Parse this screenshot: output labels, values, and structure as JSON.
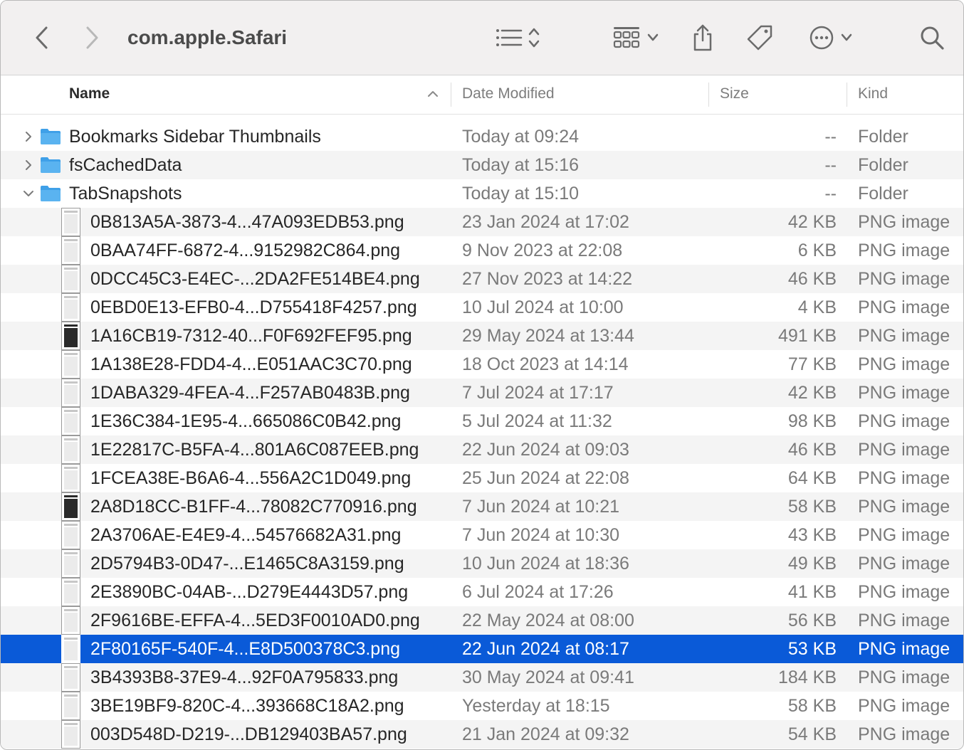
{
  "window": {
    "title": "com.apple.Safari"
  },
  "toolbar": {
    "back_icon": "chevron-left-icon",
    "forward_icon": "chevron-right-icon",
    "view_list_icon": "list-view-icon",
    "sort_icon": "up-down-chevron-icon",
    "group_icon": "grid-view-icon",
    "share_icon": "share-icon",
    "tag_icon": "tag-icon",
    "more_icon": "ellipsis-circle-icon",
    "search_icon": "search-icon"
  },
  "columns": {
    "name": "Name",
    "date": "Date Modified",
    "size": "Size",
    "kind": "Kind"
  },
  "colors": {
    "selection": "#0a5ad8",
    "folder": "#5ab3f0",
    "alt_row": "#f4f4f4"
  },
  "rows": [
    {
      "type": "folder",
      "disclosure": "collapsed",
      "name": "Bookmarks Sidebar Thumbnails",
      "date": "Today at 09:24",
      "size": "--",
      "kind": "Folder"
    },
    {
      "type": "folder",
      "disclosure": "collapsed",
      "name": "fsCachedData",
      "date": "Today at 15:16",
      "size": "--",
      "kind": "Folder"
    },
    {
      "type": "folder",
      "disclosure": "expanded",
      "name": "TabSnapshots",
      "date": "Today at 15:10",
      "size": "--",
      "kind": "Folder"
    },
    {
      "type": "file",
      "name": "0B813A5A-3873-4...47A093EDB53.png",
      "date": "23 Jan 2024 at 17:02",
      "size": "42 KB",
      "kind": "PNG image"
    },
    {
      "type": "file",
      "name": "0BAA74FF-6872-4...9152982C864.png",
      "date": "9 Nov 2023 at 22:08",
      "size": "6 KB",
      "kind": "PNG image"
    },
    {
      "type": "file",
      "name": "0DCC45C3-E4EC-...2DA2FE514BE4.png",
      "date": "27 Nov 2023 at 14:22",
      "size": "46 KB",
      "kind": "PNG image"
    },
    {
      "type": "file",
      "name": "0EBD0E13-EFB0-4...D755418F4257.png",
      "date": "10 Jul 2024 at 10:00",
      "size": "4 KB",
      "kind": "PNG image"
    },
    {
      "type": "file",
      "name": "1A16CB19-7312-40...F0F692FEF95.png",
      "date": "29 May 2024 at 13:44",
      "size": "491 KB",
      "kind": "PNG image",
      "thumb": "dark"
    },
    {
      "type": "file",
      "name": "1A138E28-FDD4-4...E051AAC3C70.png",
      "date": "18 Oct 2023 at 14:14",
      "size": "77 KB",
      "kind": "PNG image"
    },
    {
      "type": "file",
      "name": "1DABA329-4FEA-4...F257AB0483B.png",
      "date": "7 Jul 2024 at 17:17",
      "size": "42 KB",
      "kind": "PNG image"
    },
    {
      "type": "file",
      "name": "1E36C384-1E95-4...665086C0B42.png",
      "date": "5 Jul 2024 at 11:32",
      "size": "98 KB",
      "kind": "PNG image"
    },
    {
      "type": "file",
      "name": "1E22817C-B5FA-4...801A6C087EEB.png",
      "date": "22 Jun 2024 at 09:03",
      "size": "46 KB",
      "kind": "PNG image"
    },
    {
      "type": "file",
      "name": "1FCEA38E-B6A6-4...556A2C1D049.png",
      "date": "25 Jun 2024 at 22:08",
      "size": "64 KB",
      "kind": "PNG image"
    },
    {
      "type": "file",
      "name": "2A8D18CC-B1FF-4...78082C770916.png",
      "date": "7 Jun 2024 at 10:21",
      "size": "58 KB",
      "kind": "PNG image",
      "thumb": "dark"
    },
    {
      "type": "file",
      "name": "2A3706AE-E4E9-4...54576682A31.png",
      "date": "7 Jun 2024 at 10:30",
      "size": "43 KB",
      "kind": "PNG image"
    },
    {
      "type": "file",
      "name": "2D5794B3-0D47-...E1465C8A3159.png",
      "date": "10 Jun 2024 at 18:36",
      "size": "49 KB",
      "kind": "PNG image"
    },
    {
      "type": "file",
      "name": "2E3890BC-04AB-...D279E4443D57.png",
      "date": "6 Jul 2024 at 17:26",
      "size": "41 KB",
      "kind": "PNG image"
    },
    {
      "type": "file",
      "name": "2F9616BE-EFFA-4...5ED3F0010AD0.png",
      "date": "22 May 2024 at 08:00",
      "size": "56 KB",
      "kind": "PNG image"
    },
    {
      "type": "file",
      "name": "2F80165F-540F-4...E8D500378C3.png",
      "date": "22 Jun 2024 at 08:17",
      "size": "53 KB",
      "kind": "PNG image",
      "selected": true
    },
    {
      "type": "file",
      "name": "3B4393B8-37E9-4...92F0A795833.png",
      "date": "30 May 2024 at 09:41",
      "size": "184 KB",
      "kind": "PNG image"
    },
    {
      "type": "file",
      "name": "3BE19BF9-820C-4...393668C18A2.png",
      "date": "Yesterday at 18:15",
      "size": "58 KB",
      "kind": "PNG image"
    },
    {
      "type": "file",
      "name": "003D548D-D219-...DB129403BA57.png",
      "date": "21 Jan 2024 at 09:32",
      "size": "54 KB",
      "kind": "PNG image"
    }
  ]
}
